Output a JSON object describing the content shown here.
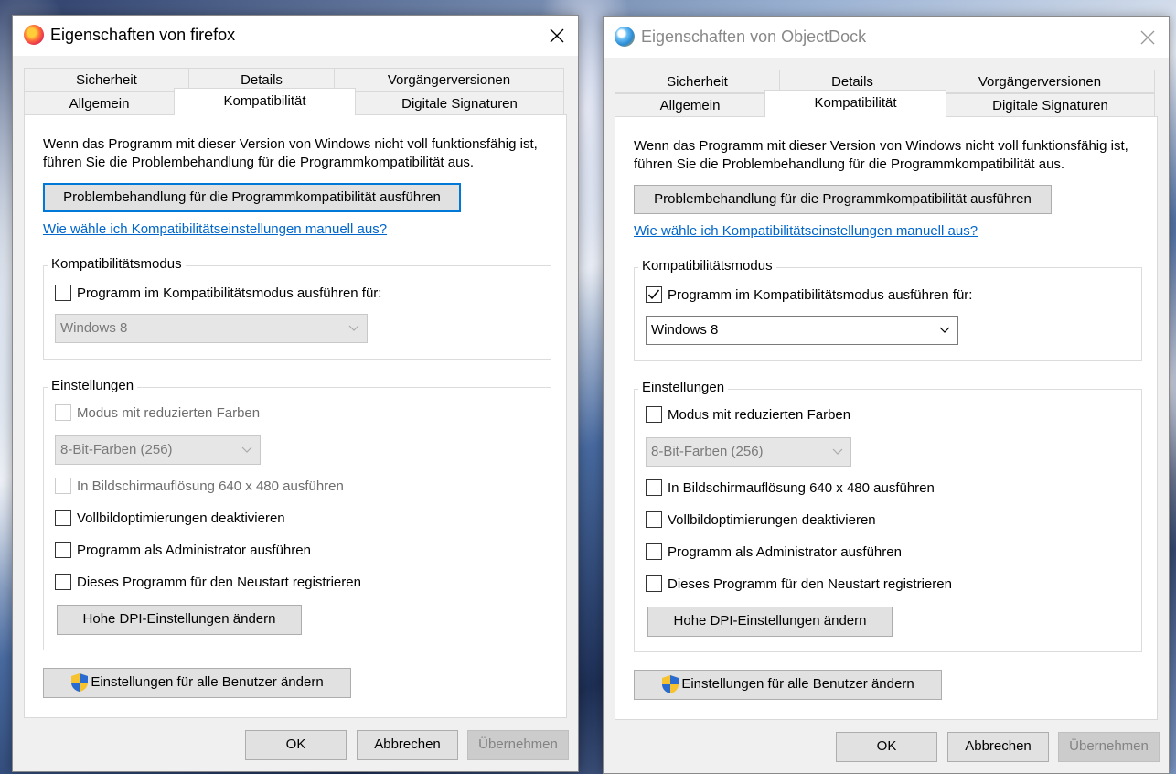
{
  "dialogs": [
    {
      "title": "Eigenschaften von firefox",
      "tabs_top": [
        "Sicherheit",
        "Details",
        "Vorgängerversionen"
      ],
      "tabs_bottom": [
        "Allgemein",
        "Kompatibilität",
        "Digitale Signaturen"
      ],
      "intro": "Wenn das Programm mit dieser Version von Windows nicht voll funktionsfähig ist, führen Sie die Problembehandlung für die Programmkompatibilität aus.",
      "troubleshoot_label": "Problembehandlung für die Programmkompatibilität ausführen",
      "help_link": "Wie wähle ich Kompatibilitätseinstellungen manuell aus?",
      "compat_group_label": "Kompatibilitätsmodus",
      "compat_check_label": "Programm im Kompatibilitätsmodus ausführen für:",
      "compat_select_value": "Windows 8",
      "settings_group_label": "Einstellungen",
      "reduced_color_label": "Modus mit reduzierten Farben",
      "color_select_value": "8-Bit-Farben (256)",
      "resolution_label": "In Bildschirmauflösung 640 x 480 ausführen",
      "fullscreen_label": "Vollbildoptimierungen deaktivieren",
      "admin_label": "Programm als Administrator ausführen",
      "restart_label": "Dieses Programm für den Neustart registrieren",
      "dpi_label": "Hohe DPI-Einstellungen ändern",
      "all_users_label": "Einstellungen für alle Benutzer ändern",
      "ok_label": "OK",
      "cancel_label": "Abbrechen",
      "apply_label": "Übernehmen"
    },
    {
      "title": "Eigenschaften von ObjectDock",
      "tabs_top": [
        "Sicherheit",
        "Details",
        "Vorgängerversionen"
      ],
      "tabs_bottom": [
        "Allgemein",
        "Kompatibilität",
        "Digitale Signaturen"
      ],
      "intro": "Wenn das Programm mit dieser Version von Windows nicht voll funktionsfähig ist, führen Sie die Problembehandlung für die Programmkompatibilität aus.",
      "troubleshoot_label": "Problembehandlung für die Programmkompatibilität ausführen",
      "help_link": "Wie wähle ich Kompatibilitätseinstellungen manuell aus?",
      "compat_group_label": "Kompatibilitätsmodus",
      "compat_check_label": "Programm im Kompatibilitätsmodus ausführen für:",
      "compat_select_value": "Windows 8",
      "settings_group_label": "Einstellungen",
      "reduced_color_label": "Modus mit reduzierten Farben",
      "color_select_value": "8-Bit-Farben (256)",
      "resolution_label": "In Bildschirmauflösung 640 x 480 ausführen",
      "fullscreen_label": "Vollbildoptimierungen deaktivieren",
      "admin_label": "Programm als Administrator ausführen",
      "restart_label": "Dieses Programm für den Neustart registrieren",
      "dpi_label": "Hohe DPI-Einstellungen ändern",
      "all_users_label": "Einstellungen für alle Benutzer ändern",
      "ok_label": "OK",
      "cancel_label": "Abbrechen",
      "apply_label": "Übernehmen"
    }
  ],
  "colors": {
    "link": "#0066cc",
    "focus": "#0078d7",
    "firefox_icon": "#ff7139",
    "objectdock_icon": "#2a8ad4"
  },
  "icons": {
    "firefox": "firefox-icon",
    "objectdock": "objectdock-icon",
    "shield": "uac-shield-icon",
    "close": "close-icon",
    "chevron": "chevron-down-icon",
    "check": "checkmark-icon"
  }
}
